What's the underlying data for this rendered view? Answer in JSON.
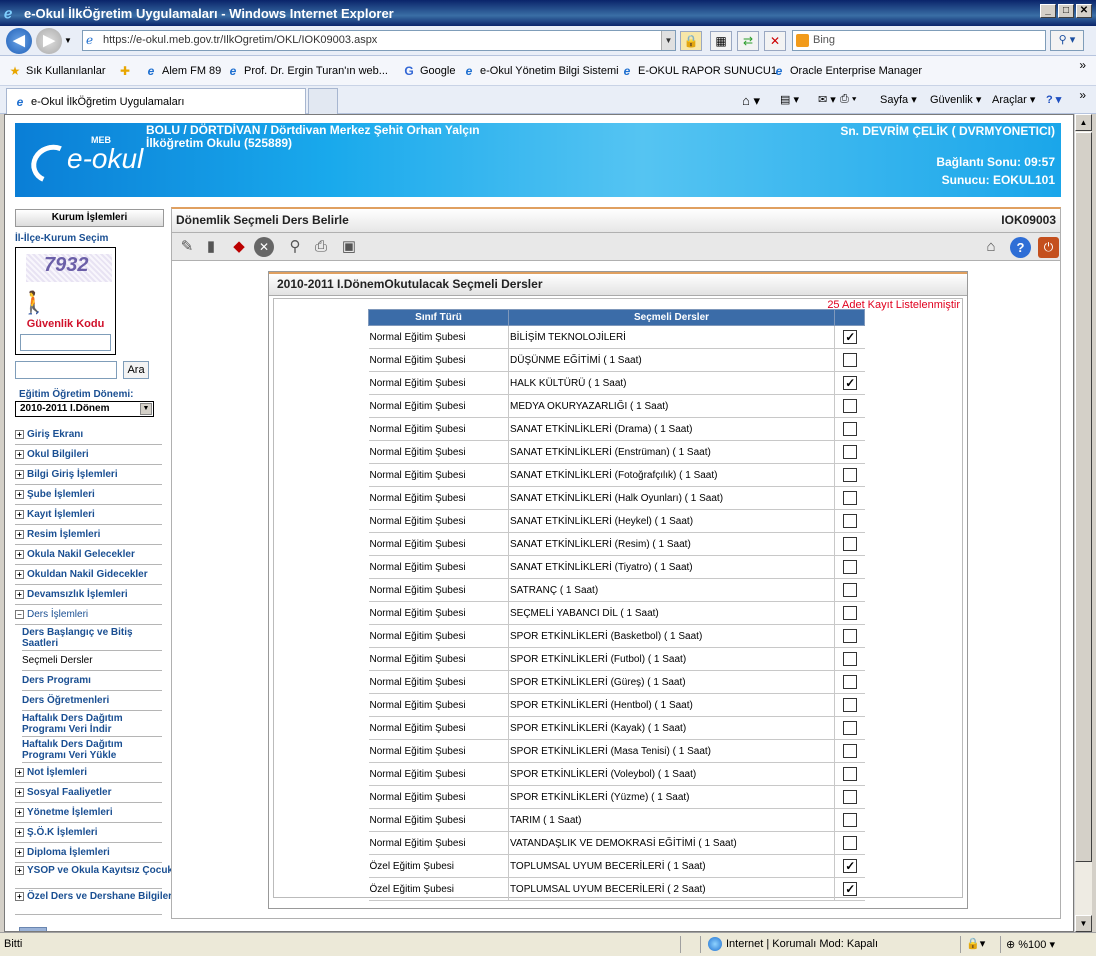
{
  "window": {
    "title": "e-Okul İlkÖğretim Uygulamaları - Windows Internet Explorer",
    "controls": [
      "_",
      "□",
      "✕"
    ]
  },
  "address": {
    "url": "https://e-okul.meb.gov.tr/IlkOgretim/OKL/IOK09003.aspx",
    "search_placeholder": "Bing"
  },
  "favorites": {
    "label": "Sık Kullanılanlar",
    "items": [
      "Alem FM 89",
      "Prof. Dr. Ergin Turan'ın web...",
      "Google",
      "e-Okul Yönetim Bilgi Sistemi",
      "E-OKUL RAPOR SUNUCU1",
      "Oracle Enterprise Manager"
    ]
  },
  "tab": {
    "title": "e-Okul İlkÖğretim Uygulamaları"
  },
  "commands": [
    "Sayfa",
    "Güvenlik",
    "Araçlar"
  ],
  "header": {
    "school_line1": "BOLU / DÖRTDİVAN / Dörtdivan Merkez Şehit Orhan Yalçın",
    "school_line2": "İlköğretim Okulu (525889)",
    "user": "Sn. DEVRİM ÇELİK ( DVRMYONETICI)",
    "connection": "Bağlantı Sonu: 09:57",
    "server": "Sunucu: EOKUL101",
    "logo_text": "e-okul",
    "logo_meb": "MEB"
  },
  "sidebar": {
    "title": "Kurum İşlemleri",
    "selection_link": "İl-İlçe-Kurum Seçim",
    "captcha_value": "7932",
    "captcha_label": "Güvenlik Kodu",
    "search_button": "Ara",
    "term_label": "Eğitim Öğretim Dönemi:",
    "term_value": "2010-2011 I.Dönem",
    "menu_before": [
      "Giriş Ekranı",
      "Okul Bilgileri",
      "Bilgi Giriş İşlemleri",
      "Şube İşlemleri",
      "Kayıt İşlemleri",
      "Resim İşlemleri",
      "Okula Nakil Gelecekler",
      "Okuldan Nakil Gidecekler",
      "Devamsızlık İşlemleri"
    ],
    "menu_open": "Ders İşlemleri",
    "submenu": [
      "Ders Başlangıç ve Bitiş Saatleri",
      "Seçmeli Dersler",
      "Ders Programı",
      "Ders Öğretmenleri",
      "Haftalık Ders Dağıtım Programı Veri İndir",
      "Haftalık Ders Dağıtım Programı Veri Yükle"
    ],
    "menu_after": [
      "Not İşlemleri",
      "Sosyal Faaliyetler",
      "Yönetme İşlemleri",
      "Ş.Ö.K İşlemleri",
      "Diploma İşlemleri",
      "YSOP ve Okula Kayıtsız Çocuklar",
      "Özel Ders ve Dershane Bilgileri"
    ]
  },
  "main": {
    "title": "Dönemlik Seçmeli Ders Belirle",
    "code": "IOK09003",
    "panel_title": "2010-2011 I.DönemOkutulacak Seçmeli Dersler",
    "record_count": "25 Adet Kayıt Listelenmiştir",
    "columns": [
      "Sınıf Türü",
      "Seçmeli Dersler",
      ""
    ],
    "rows": [
      {
        "type": "Normal Eğitim Şubesi",
        "course": "BİLİŞİM TEKNOLOJİLERİ",
        "checked": true
      },
      {
        "type": "Normal Eğitim Şubesi",
        "course": "DÜŞÜNME EĞİTİMİ ( 1 Saat)",
        "checked": false
      },
      {
        "type": "Normal Eğitim Şubesi",
        "course": "HALK KÜLTÜRÜ ( 1 Saat)",
        "checked": true
      },
      {
        "type": "Normal Eğitim Şubesi",
        "course": "MEDYA OKURYAZARLIĞI ( 1 Saat)",
        "checked": false
      },
      {
        "type": "Normal Eğitim Şubesi",
        "course": "SANAT ETKİNLİKLERİ (Drama) ( 1 Saat)",
        "checked": false
      },
      {
        "type": "Normal Eğitim Şubesi",
        "course": "SANAT ETKİNLİKLERİ (Enstrüman) ( 1 Saat)",
        "checked": false
      },
      {
        "type": "Normal Eğitim Şubesi",
        "course": "SANAT ETKİNLİKLERİ (Fotoğrafçılık) ( 1 Saat)",
        "checked": false
      },
      {
        "type": "Normal Eğitim Şubesi",
        "course": "SANAT ETKİNLİKLERİ (Halk Oyunları) ( 1 Saat)",
        "checked": false
      },
      {
        "type": "Normal Eğitim Şubesi",
        "course": "SANAT ETKİNLİKLERİ (Heykel) ( 1 Saat)",
        "checked": false
      },
      {
        "type": "Normal Eğitim Şubesi",
        "course": "SANAT ETKİNLİKLERİ (Resim) ( 1 Saat)",
        "checked": false
      },
      {
        "type": "Normal Eğitim Şubesi",
        "course": "SANAT ETKİNLİKLERİ (Tiyatro) ( 1 Saat)",
        "checked": false
      },
      {
        "type": "Normal Eğitim Şubesi",
        "course": "SATRANÇ ( 1 Saat)",
        "checked": false
      },
      {
        "type": "Normal Eğitim Şubesi",
        "course": "SEÇMELİ YABANCI DİL ( 1 Saat)",
        "checked": false
      },
      {
        "type": "Normal Eğitim Şubesi",
        "course": "SPOR ETKİNLİKLERİ (Basketbol) ( 1 Saat)",
        "checked": false
      },
      {
        "type": "Normal Eğitim Şubesi",
        "course": "SPOR ETKİNLİKLERİ (Futbol) ( 1 Saat)",
        "checked": false
      },
      {
        "type": "Normal Eğitim Şubesi",
        "course": "SPOR ETKİNLİKLERİ (Güreş) ( 1 Saat)",
        "checked": false
      },
      {
        "type": "Normal Eğitim Şubesi",
        "course": "SPOR ETKİNLİKLERİ (Hentbol) ( 1 Saat)",
        "checked": false
      },
      {
        "type": "Normal Eğitim Şubesi",
        "course": "SPOR ETKİNLİKLERİ (Kayak) ( 1 Saat)",
        "checked": false
      },
      {
        "type": "Normal Eğitim Şubesi",
        "course": "SPOR ETKİNLİKLERİ (Masa Tenisi) ( 1 Saat)",
        "checked": false
      },
      {
        "type": "Normal Eğitim Şubesi",
        "course": "SPOR ETKİNLİKLERİ (Voleybol) ( 1 Saat)",
        "checked": false
      },
      {
        "type": "Normal Eğitim Şubesi",
        "course": "SPOR ETKİNLİKLERİ (Yüzme) ( 1 Saat)",
        "checked": false
      },
      {
        "type": "Normal Eğitim Şubesi",
        "course": "TARIM ( 1 Saat)",
        "checked": false
      },
      {
        "type": "Normal Eğitim Şubesi",
        "course": "VATANDAŞLIK VE DEMOKRASİ EĞİTİMİ ( 1 Saat)",
        "checked": false
      },
      {
        "type": "Özel Eğitim Şubesi",
        "course": "TOPLUMSAL UYUM BECERİLERİ ( 1 Saat)",
        "checked": true
      },
      {
        "type": "Özel Eğitim Şubesi",
        "course": "TOPLUMSAL UYUM BECERİLERİ ( 2 Saat)",
        "checked": true
      }
    ]
  },
  "status": {
    "left": "Bitti",
    "zone": "Internet | Korumalı Mod: Kapalı",
    "zoom": "%100"
  },
  "colors": {
    "banner": "#19a9ec",
    "table_header": "#3b6ca8",
    "count_text": "#e0001e"
  }
}
